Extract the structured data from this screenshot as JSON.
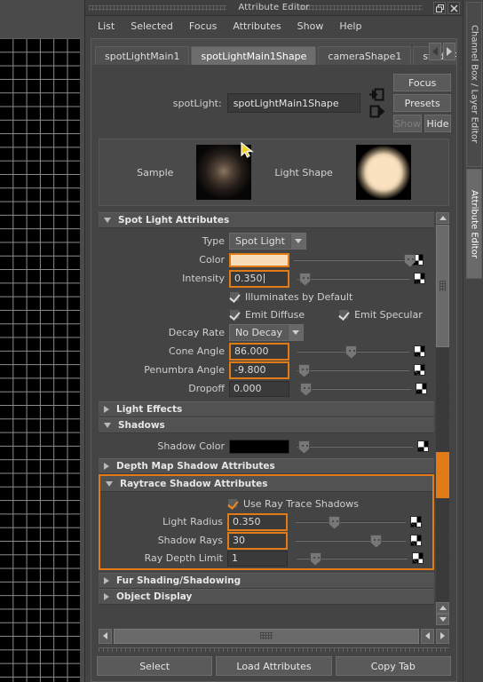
{
  "window": {
    "title": "Attribute Editor",
    "restore_icon": "restore-icon",
    "close_icon": "close-icon"
  },
  "menubar": {
    "items": [
      {
        "label": "List"
      },
      {
        "label": "Selected"
      },
      {
        "label": "Focus"
      },
      {
        "label": "Attributes"
      },
      {
        "label": "Show"
      },
      {
        "label": "Help"
      }
    ]
  },
  "tabs": {
    "items": [
      {
        "label": "spotLightMain1",
        "active": false
      },
      {
        "label": "spotLightMain1Shape",
        "active": true
      },
      {
        "label": "cameraShape1",
        "active": false
      },
      {
        "label": "studioRend",
        "active": false
      }
    ],
    "prev_icon": "chevron-left-icon",
    "next_icon": "chevron-right-icon"
  },
  "node": {
    "type_label": "spotLight:",
    "name_value": "spotLightMain1Shape",
    "input_connection_icon": "input-connection-icon",
    "output_connection_icon": "output-connection-icon",
    "focus_button": "Focus",
    "presets_button": "Presets",
    "show_button": "Show",
    "hide_button": "Hide"
  },
  "preview": {
    "sample_label": "Sample",
    "light_shape_label": "Light Shape",
    "light_color_hex": "#fae2c0",
    "cursor_icon": "cursor-arrow-icon"
  },
  "sections": {
    "spot_light_attributes": {
      "title": "Spot Light Attributes",
      "expanded": true,
      "type_label": "Type",
      "type_value": "Spot Light",
      "color_label": "Color",
      "color_hex": "#f8deb8",
      "color_slider_pct": 97,
      "intensity_label": "Intensity",
      "intensity_value": "0.350",
      "intensity_slider_pct": 4,
      "illuminates_by_default_label": "Illuminates by Default",
      "illuminates_by_default_checked": true,
      "emit_diffuse_label": "Emit Diffuse",
      "emit_diffuse_checked": true,
      "emit_specular_label": "Emit Specular",
      "emit_specular_checked": true,
      "decay_rate_label": "Decay Rate",
      "decay_rate_value": "No Decay",
      "cone_angle_label": "Cone Angle",
      "cone_angle_value": "86.000",
      "cone_angle_slider_pct": 43,
      "penumbra_angle_label": "Penumbra Angle",
      "penumbra_angle_value": "-9.800",
      "penumbra_angle_slider_pct": 1,
      "dropoff_label": "Dropoff",
      "dropoff_value": "0.000",
      "dropoff_slider_pct": 1
    },
    "light_effects": {
      "title": "Light Effects",
      "expanded": false
    },
    "shadows": {
      "title": "Shadows",
      "expanded": true,
      "shadow_color_label": "Shadow Color",
      "shadow_color_hex": "#000000",
      "shadow_color_slider_pct": 1
    },
    "depth_map_shadow_attributes": {
      "title": "Depth Map Shadow Attributes",
      "expanded": false
    },
    "raytrace_shadow_attributes": {
      "title": "Raytrace Shadow Attributes",
      "expanded": true,
      "highlighted": true,
      "use_ray_trace_shadows_label": "Use Ray Trace Shadows",
      "use_ray_trace_shadows_checked": true,
      "light_radius_label": "Light Radius",
      "light_radius_value": "0.350",
      "light_radius_slider_pct": 30,
      "shadow_rays_label": "Shadow Rays",
      "shadow_rays_value": "30",
      "shadow_rays_slider_pct": 68,
      "ray_depth_limit_label": "Ray Depth Limit",
      "ray_depth_limit_value": "1",
      "ray_depth_limit_slider_pct": 11
    },
    "fur_shading_shadowing": {
      "title": "Fur Shading/Shadowing",
      "expanded": false
    },
    "object_display": {
      "title": "Object Display",
      "expanded": false
    }
  },
  "bottom_buttons": {
    "select": "Select",
    "load_attributes": "Load Attributes",
    "copy_tab": "Copy Tab"
  },
  "rail": {
    "channel_box_tab": "Channel Box / Layer Editor",
    "attribute_editor_tab": "Attribute Editor"
  },
  "colors": {
    "accent_orange": "#e07b18",
    "panel_bg": "#444444",
    "header_bg": "#525252",
    "field_bg": "#3a3a3a"
  }
}
